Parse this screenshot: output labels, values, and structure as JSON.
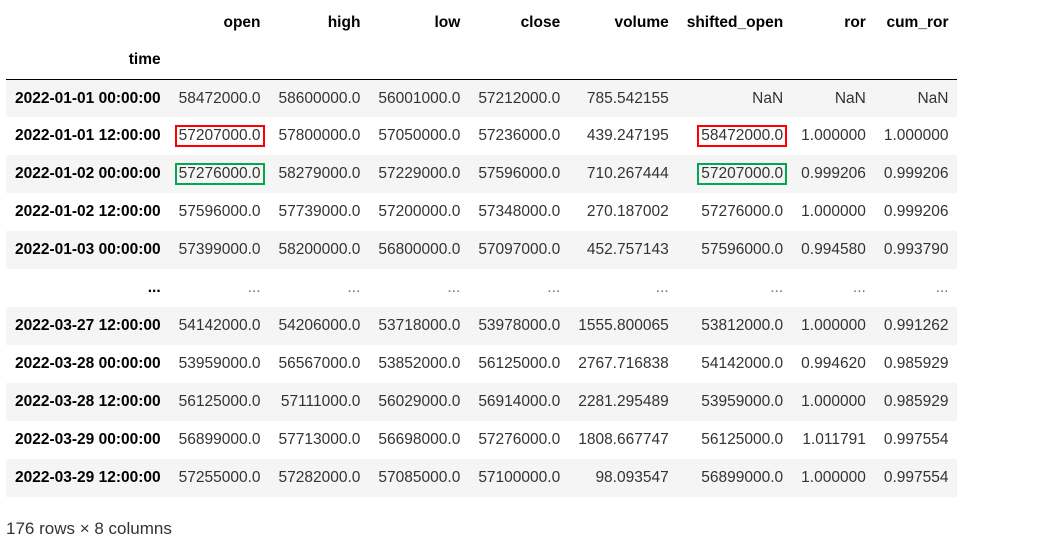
{
  "table": {
    "index_name": "time",
    "columns": [
      "open",
      "high",
      "low",
      "close",
      "volume",
      "shifted_open",
      "ror",
      "cum_ror"
    ],
    "rows": [
      {
        "index": "2022-01-01 00:00:00",
        "values": [
          "58472000.0",
          "58600000.0",
          "56001000.0",
          "57212000.0",
          "785.542155",
          "NaN",
          "NaN",
          "NaN"
        ]
      },
      {
        "index": "2022-01-01 12:00:00",
        "values": [
          "57207000.0",
          "57800000.0",
          "57050000.0",
          "57236000.0",
          "439.247195",
          "58472000.0",
          "1.000000",
          "1.000000"
        ]
      },
      {
        "index": "2022-01-02 00:00:00",
        "values": [
          "57276000.0",
          "58279000.0",
          "57229000.0",
          "57596000.0",
          "710.267444",
          "57207000.0",
          "0.999206",
          "0.999206"
        ]
      },
      {
        "index": "2022-01-02 12:00:00",
        "values": [
          "57596000.0",
          "57739000.0",
          "57200000.0",
          "57348000.0",
          "270.187002",
          "57276000.0",
          "1.000000",
          "0.999206"
        ]
      },
      {
        "index": "2022-01-03 00:00:00",
        "values": [
          "57399000.0",
          "58200000.0",
          "56800000.0",
          "57097000.0",
          "452.757143",
          "57596000.0",
          "0.994580",
          "0.993790"
        ]
      },
      {
        "index": "...",
        "values": [
          "...",
          "...",
          "...",
          "...",
          "...",
          "...",
          "...",
          "..."
        ]
      },
      {
        "index": "2022-03-27 12:00:00",
        "values": [
          "54142000.0",
          "54206000.0",
          "53718000.0",
          "53978000.0",
          "1555.800065",
          "53812000.0",
          "1.000000",
          "0.991262"
        ]
      },
      {
        "index": "2022-03-28 00:00:00",
        "values": [
          "53959000.0",
          "56567000.0",
          "53852000.0",
          "56125000.0",
          "2767.716838",
          "54142000.0",
          "0.994620",
          "0.985929"
        ]
      },
      {
        "index": "2022-03-28 12:00:00",
        "values": [
          "56125000.0",
          "57111000.0",
          "56029000.0",
          "56914000.0",
          "2281.295489",
          "53959000.0",
          "1.000000",
          "0.985929"
        ]
      },
      {
        "index": "2022-03-29 00:00:00",
        "values": [
          "56899000.0",
          "57713000.0",
          "56698000.0",
          "57276000.0",
          "1808.667747",
          "56125000.0",
          "1.011791",
          "0.997554"
        ]
      },
      {
        "index": "2022-03-29 12:00:00",
        "values": [
          "57255000.0",
          "57282000.0",
          "57085000.0",
          "57100000.0",
          "98.093547",
          "56899000.0",
          "1.000000",
          "0.997554"
        ]
      }
    ]
  },
  "highlight_colors": {
    "red": "#ff0000",
    "green": "#00a84f"
  },
  "footer": {
    "shape": "176 rows × 8 columns"
  }
}
